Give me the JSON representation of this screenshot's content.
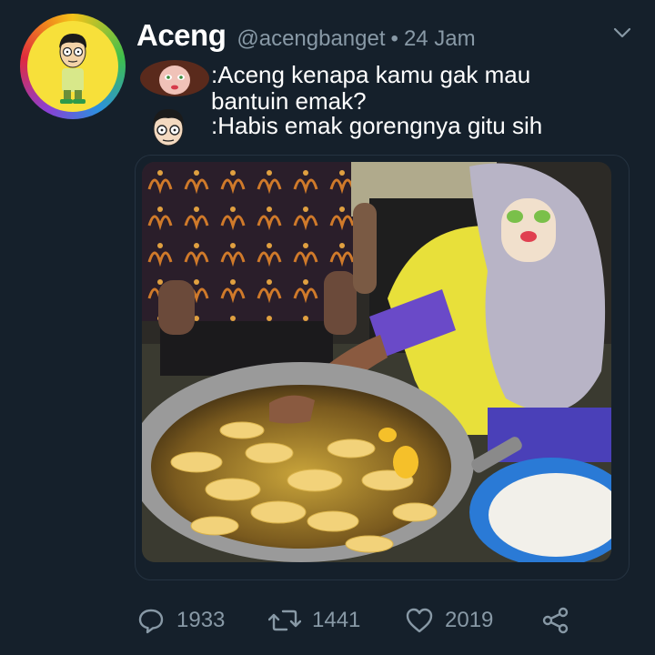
{
  "tweet": {
    "display_name": "Aceng",
    "handle": "@acengbanget",
    "separator": "•",
    "time": "24 Jam",
    "line1": ":Aceng kenapa kamu gak mau bantuin emak?",
    "line2": ":Habis emak gorengnya gitu sih"
  },
  "actions": {
    "replies": "1933",
    "retweets": "1441",
    "likes": "2019"
  },
  "icons": {
    "avatar": "cartoon-boy-avatar",
    "more": "chevron-down-icon",
    "reply": "reply-icon",
    "retweet": "retweet-icon",
    "like": "heart-icon",
    "share": "share-icon"
  },
  "colors": {
    "background": "#15202b",
    "secondary_text": "#8899a6",
    "primary_text": "#ffffff"
  }
}
